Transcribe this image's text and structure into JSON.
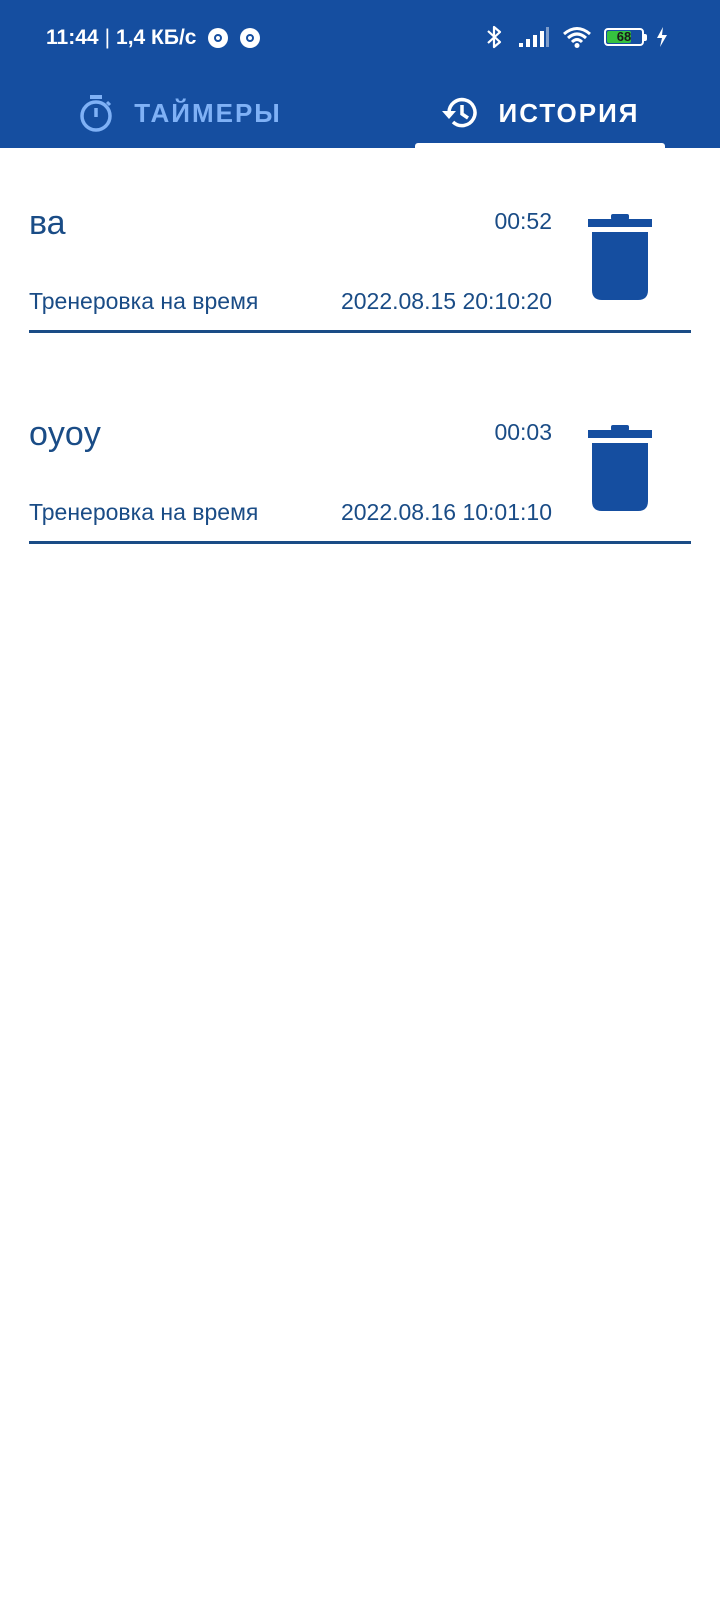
{
  "status_bar": {
    "time": "11:44",
    "network_speed": "1,4 КБ/с",
    "battery_level": "68",
    "battery_color": "#36c23f"
  },
  "theme": {
    "primary": "#154ea0",
    "text": "#1a4c86",
    "inactive_tab": "#7fb1f6"
  },
  "tabs": [
    {
      "label": "ТАЙМЕРЫ",
      "icon": "stopwatch-icon",
      "active": false
    },
    {
      "label": "ИСТОРИЯ",
      "icon": "history-icon",
      "active": true
    }
  ],
  "history": [
    {
      "name": "ва",
      "duration": "00:52",
      "type": "Тренеровка на время",
      "datetime": "2022.08.15 20:10:20",
      "delete_icon": "trash-icon"
    },
    {
      "name": "oyoy",
      "duration": "00:03",
      "type": "Тренеровка на время",
      "datetime": "2022.08.16 10:01:10",
      "delete_icon": "trash-icon"
    }
  ]
}
